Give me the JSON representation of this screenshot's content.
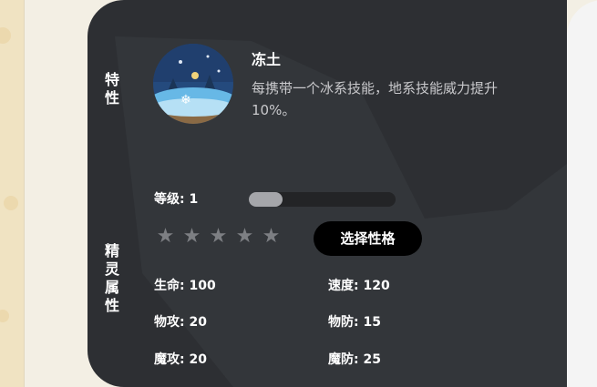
{
  "sections": {
    "trait_label": "特性",
    "attr_label": "精灵属性"
  },
  "trait": {
    "icon": "snowy-night-icon",
    "name": "冻土",
    "description": "每携带一个冰系技能，地系技能威力提升10%。"
  },
  "level": {
    "label": "等级: 1",
    "progress": 0.23
  },
  "rating": {
    "stars": [
      "★",
      "★",
      "★",
      "★",
      "★"
    ],
    "filled": 0,
    "color": "#7d7f83"
  },
  "nature_button": {
    "label": "选择性格"
  },
  "stats": {
    "hp": "生命: 100",
    "speed": "速度: 120",
    "atk": "物攻: 20",
    "def": "物防: 15",
    "matk": "魔攻: 20",
    "mdef": "魔防: 25"
  },
  "colors": {
    "card_bg": "#2d2f33",
    "button_bg": "#000000",
    "bar_fill": "#a5a6aa"
  }
}
